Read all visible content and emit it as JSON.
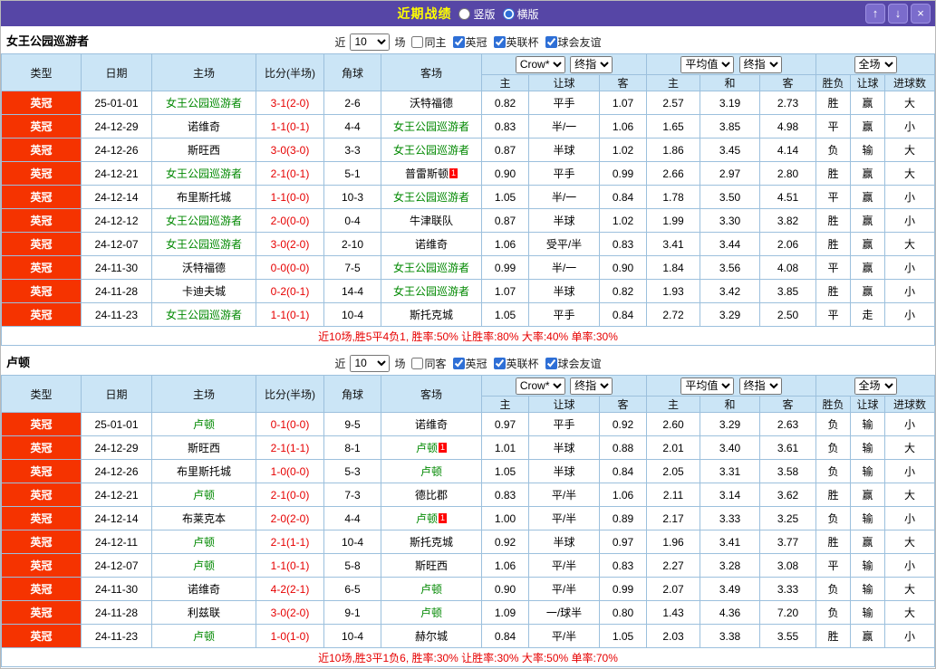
{
  "titlebar": {
    "title": "近期战绩",
    "layout_options": [
      {
        "label": "竖版",
        "checked": false
      },
      {
        "label": "横版",
        "checked": true
      }
    ],
    "up_symbol": "↑",
    "down_symbol": "↓",
    "close_symbol": "×"
  },
  "colors": {
    "titlebar_bg": "#5646a6",
    "title_yellow": "#ffff00",
    "btn_purple": "#7b6ccc",
    "head_bg": "#cbe5f6",
    "grid": "#9cc0dd",
    "type_bg": "#f53300",
    "team_green": "#008800",
    "score_red": "#e60000",
    "summary_red": "#e60000",
    "c_red": "#ff0000",
    "c_green": "#009900",
    "c_blue": "#0000ee"
  },
  "result_colors": {
    "胜": "red",
    "平": "green",
    "负": "blue",
    "赢": "red",
    "走": "green",
    "输": "blue",
    "大": "red",
    "小": "blue"
  },
  "controls": {
    "near": "近",
    "count": "10",
    "games": "场"
  },
  "table_header": {
    "type": "类型",
    "date": "日期",
    "home": "主场",
    "score": "比分(半场)",
    "corner": "角球",
    "away": "客场",
    "selects": {
      "bookmaker": "Crow*",
      "final1": "终指",
      "average": "平均值",
      "final2": "终指",
      "fulltime": "全场"
    },
    "sub_labels": [
      "主",
      "让球",
      "客",
      "主",
      "和",
      "客",
      "胜负",
      "让球",
      "进球数"
    ]
  },
  "sections": [
    {
      "team": "女王公园巡游者",
      "filters": [
        {
          "label": "同主",
          "checked": false
        },
        {
          "label": "英冠",
          "checked": true
        },
        {
          "label": "英联杯",
          "checked": true
        },
        {
          "label": "球会友谊",
          "checked": true
        }
      ],
      "summary": "近10场,胜5平4负1, 胜率:50% 让胜率:80% 大率:40% 单率:30%",
      "rows": [
        {
          "lg": "英冠",
          "date": "25-01-01",
          "home": "女王公园巡游者",
          "ht": true,
          "hc": "",
          "score": "3-1(2-0)",
          "corner": "2-6",
          "away": "沃特福德",
          "at": false,
          "ac": "",
          "o1": "0.82",
          "line": "平手",
          "o2": "1.07",
          "e1": "2.57",
          "e2": "3.19",
          "e3": "2.73",
          "res": "胜",
          "hres": "赢",
          "gres": "大"
        },
        {
          "lg": "英冠",
          "date": "24-12-29",
          "home": "诺维奇",
          "ht": false,
          "hc": "",
          "score": "1-1(0-1)",
          "corner": "4-4",
          "away": "女王公园巡游者",
          "at": true,
          "ac": "",
          "o1": "0.83",
          "line": "半/一",
          "o2": "1.06",
          "e1": "1.65",
          "e2": "3.85",
          "e3": "4.98",
          "res": "平",
          "hres": "赢",
          "gres": "小"
        },
        {
          "lg": "英冠",
          "date": "24-12-26",
          "home": "斯旺西",
          "ht": false,
          "hc": "",
          "score": "3-0(3-0)",
          "corner": "3-3",
          "away": "女王公园巡游者",
          "at": true,
          "ac": "",
          "o1": "0.87",
          "line": "半球",
          "o2": "1.02",
          "e1": "1.86",
          "e2": "3.45",
          "e3": "4.14",
          "res": "负",
          "hres": "输",
          "gres": "大"
        },
        {
          "lg": "英冠",
          "date": "24-12-21",
          "home": "女王公园巡游者",
          "ht": true,
          "hc": "",
          "score": "2-1(0-1)",
          "corner": "5-1",
          "away": "普雷斯顿",
          "at": false,
          "ac": "1",
          "o1": "0.90",
          "line": "平手",
          "o2": "0.99",
          "e1": "2.66",
          "e2": "2.97",
          "e3": "2.80",
          "res": "胜",
          "hres": "赢",
          "gres": "大"
        },
        {
          "lg": "英冠",
          "date": "24-12-14",
          "home": "布里斯托城",
          "ht": false,
          "hc": "",
          "score": "1-1(0-0)",
          "corner": "10-3",
          "away": "女王公园巡游者",
          "at": true,
          "ac": "",
          "o1": "1.05",
          "line": "半/一",
          "o2": "0.84",
          "e1": "1.78",
          "e2": "3.50",
          "e3": "4.51",
          "res": "平",
          "hres": "赢",
          "gres": "小"
        },
        {
          "lg": "英冠",
          "date": "24-12-12",
          "home": "女王公园巡游者",
          "ht": true,
          "hc": "",
          "score": "2-0(0-0)",
          "corner": "0-4",
          "away": "牛津联队",
          "at": false,
          "ac": "",
          "o1": "0.87",
          "line": "半球",
          "o2": "1.02",
          "e1": "1.99",
          "e2": "3.30",
          "e3": "3.82",
          "res": "胜",
          "hres": "赢",
          "gres": "小"
        },
        {
          "lg": "英冠",
          "date": "24-12-07",
          "home": "女王公园巡游者",
          "ht": true,
          "hc": "",
          "score": "3-0(2-0)",
          "corner": "2-10",
          "away": "诺维奇",
          "at": false,
          "ac": "",
          "o1": "1.06",
          "line": "受平/半",
          "o2": "0.83",
          "e1": "3.41",
          "e2": "3.44",
          "e3": "2.06",
          "res": "胜",
          "hres": "赢",
          "gres": "大"
        },
        {
          "lg": "英冠",
          "date": "24-11-30",
          "home": "沃特福德",
          "ht": false,
          "hc": "",
          "score": "0-0(0-0)",
          "corner": "7-5",
          "away": "女王公园巡游者",
          "at": true,
          "ac": "",
          "o1": "0.99",
          "line": "半/一",
          "o2": "0.90",
          "e1": "1.84",
          "e2": "3.56",
          "e3": "4.08",
          "res": "平",
          "hres": "赢",
          "gres": "小"
        },
        {
          "lg": "英冠",
          "date": "24-11-28",
          "home": "卡迪夫城",
          "ht": false,
          "hc": "",
          "score": "0-2(0-1)",
          "corner": "14-4",
          "away": "女王公园巡游者",
          "at": true,
          "ac": "",
          "o1": "1.07",
          "line": "半球",
          "o2": "0.82",
          "e1": "1.93",
          "e2": "3.42",
          "e3": "3.85",
          "res": "胜",
          "hres": "赢",
          "gres": "小"
        },
        {
          "lg": "英冠",
          "date": "24-11-23",
          "home": "女王公园巡游者",
          "ht": true,
          "hc": "",
          "score": "1-1(0-1)",
          "corner": "10-4",
          "away": "斯托克城",
          "at": false,
          "ac": "",
          "o1": "1.05",
          "line": "平手",
          "o2": "0.84",
          "e1": "2.72",
          "e2": "3.29",
          "e3": "2.50",
          "res": "平",
          "hres": "走",
          "gres": "小"
        }
      ]
    },
    {
      "team": "卢顿",
      "filters": [
        {
          "label": "同客",
          "checked": false
        },
        {
          "label": "英冠",
          "checked": true
        },
        {
          "label": "英联杯",
          "checked": true
        },
        {
          "label": "球会友谊",
          "checked": true
        }
      ],
      "summary": "近10场,胜3平1负6, 胜率:30% 让胜率:30% 大率:50% 单率:70%",
      "rows": [
        {
          "lg": "英冠",
          "date": "25-01-01",
          "home": "卢顿",
          "ht": true,
          "hc": "",
          "score": "0-1(0-0)",
          "corner": "9-5",
          "away": "诺维奇",
          "at": false,
          "ac": "",
          "o1": "0.97",
          "line": "平手",
          "o2": "0.92",
          "e1": "2.60",
          "e2": "3.29",
          "e3": "2.63",
          "res": "负",
          "hres": "输",
          "gres": "小"
        },
        {
          "lg": "英冠",
          "date": "24-12-29",
          "home": "斯旺西",
          "ht": false,
          "hc": "",
          "score": "2-1(1-1)",
          "corner": "8-1",
          "away": "卢顿",
          "at": true,
          "ac": "1",
          "o1": "1.01",
          "line": "半球",
          "o2": "0.88",
          "e1": "2.01",
          "e2": "3.40",
          "e3": "3.61",
          "res": "负",
          "hres": "输",
          "gres": "大"
        },
        {
          "lg": "英冠",
          "date": "24-12-26",
          "home": "布里斯托城",
          "ht": false,
          "hc": "",
          "score": "1-0(0-0)",
          "corner": "5-3",
          "away": "卢顿",
          "at": true,
          "ac": "",
          "o1": "1.05",
          "line": "半球",
          "o2": "0.84",
          "e1": "2.05",
          "e2": "3.31",
          "e3": "3.58",
          "res": "负",
          "hres": "输",
          "gres": "小"
        },
        {
          "lg": "英冠",
          "date": "24-12-21",
          "home": "卢顿",
          "ht": true,
          "hc": "",
          "score": "2-1(0-0)",
          "corner": "7-3",
          "away": "德比郡",
          "at": false,
          "ac": "",
          "o1": "0.83",
          "line": "平/半",
          "o2": "1.06",
          "e1": "2.11",
          "e2": "3.14",
          "e3": "3.62",
          "res": "胜",
          "hres": "赢",
          "gres": "大"
        },
        {
          "lg": "英冠",
          "date": "24-12-14",
          "home": "布莱克本",
          "ht": false,
          "hc": "",
          "score": "2-0(2-0)",
          "corner": "4-4",
          "away": "卢顿",
          "at": true,
          "ac": "1",
          "o1": "1.00",
          "line": "平/半",
          "o2": "0.89",
          "e1": "2.17",
          "e2": "3.33",
          "e3": "3.25",
          "res": "负",
          "hres": "输",
          "gres": "小"
        },
        {
          "lg": "英冠",
          "date": "24-12-11",
          "home": "卢顿",
          "ht": true,
          "hc": "",
          "score": "2-1(1-1)",
          "corner": "10-4",
          "away": "斯托克城",
          "at": false,
          "ac": "",
          "o1": "0.92",
          "line": "半球",
          "o2": "0.97",
          "e1": "1.96",
          "e2": "3.41",
          "e3": "3.77",
          "res": "胜",
          "hres": "赢",
          "gres": "大"
        },
        {
          "lg": "英冠",
          "date": "24-12-07",
          "home": "卢顿",
          "ht": true,
          "hc": "",
          "score": "1-1(0-1)",
          "corner": "5-8",
          "away": "斯旺西",
          "at": false,
          "ac": "",
          "o1": "1.06",
          "line": "平/半",
          "o2": "0.83",
          "e1": "2.27",
          "e2": "3.28",
          "e3": "3.08",
          "res": "平",
          "hres": "输",
          "gres": "小"
        },
        {
          "lg": "英冠",
          "date": "24-11-30",
          "home": "诺维奇",
          "ht": false,
          "hc": "",
          "score": "4-2(2-1)",
          "corner": "6-5",
          "away": "卢顿",
          "at": true,
          "ac": "",
          "o1": "0.90",
          "line": "平/半",
          "o2": "0.99",
          "e1": "2.07",
          "e2": "3.49",
          "e3": "3.33",
          "res": "负",
          "hres": "输",
          "gres": "大"
        },
        {
          "lg": "英冠",
          "date": "24-11-28",
          "home": "利兹联",
          "ht": false,
          "hc": "",
          "score": "3-0(2-0)",
          "corner": "9-1",
          "away": "卢顿",
          "at": true,
          "ac": "",
          "o1": "1.09",
          "line": "一/球半",
          "o2": "0.80",
          "e1": "1.43",
          "e2": "4.36",
          "e3": "7.20",
          "res": "负",
          "hres": "输",
          "gres": "大"
        },
        {
          "lg": "英冠",
          "date": "24-11-23",
          "home": "卢顿",
          "ht": true,
          "hc": "",
          "score": "1-0(1-0)",
          "corner": "10-4",
          "away": "赫尔城",
          "at": false,
          "ac": "",
          "o1": "0.84",
          "line": "平/半",
          "o2": "1.05",
          "e1": "2.03",
          "e2": "3.38",
          "e3": "3.55",
          "res": "胜",
          "hres": "赢",
          "gres": "小"
        }
      ]
    }
  ]
}
